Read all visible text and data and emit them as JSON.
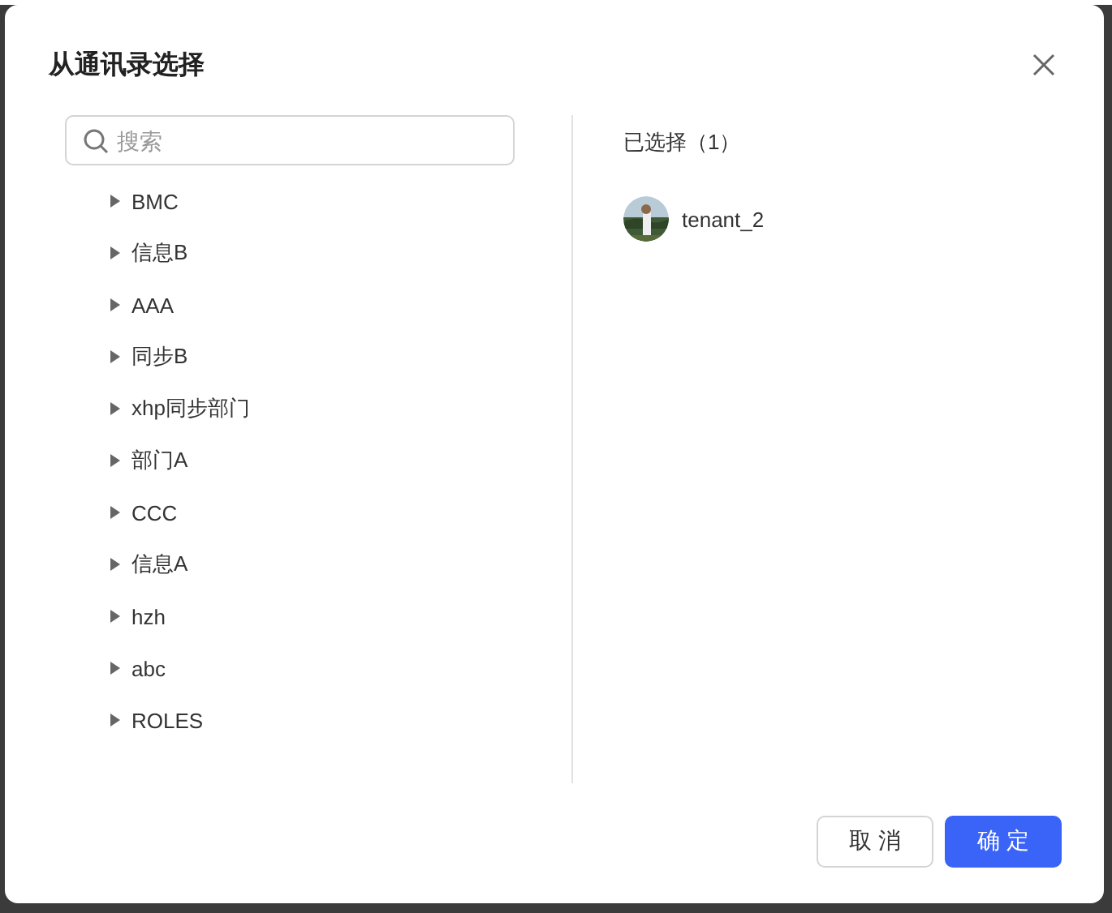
{
  "dialog": {
    "title": "从通讯录选择"
  },
  "search": {
    "placeholder": "搜索"
  },
  "tree": [
    {
      "label": "BMC",
      "expanded": false
    },
    {
      "label": "信息B",
      "expanded": false
    },
    {
      "label": "AAA",
      "expanded": false
    },
    {
      "label": "同步B",
      "expanded": false
    },
    {
      "label": "xhp同步部门",
      "expanded": false
    },
    {
      "label": "部门A",
      "expanded": false
    },
    {
      "label": "CCC",
      "expanded": false
    },
    {
      "label": "信息A",
      "expanded": false
    },
    {
      "label": "hzh",
      "expanded": false
    },
    {
      "label": "abc",
      "expanded": false
    },
    {
      "label": "ROLES",
      "expanded": false
    }
  ],
  "selected_panel": {
    "heading": "已选择（1）",
    "items": [
      {
        "name": "tenant_2"
      }
    ]
  },
  "buttons": [
    {
      "label": "取 消",
      "kind": "secondary"
    },
    {
      "label": "确 定",
      "kind": "primary"
    }
  ]
}
